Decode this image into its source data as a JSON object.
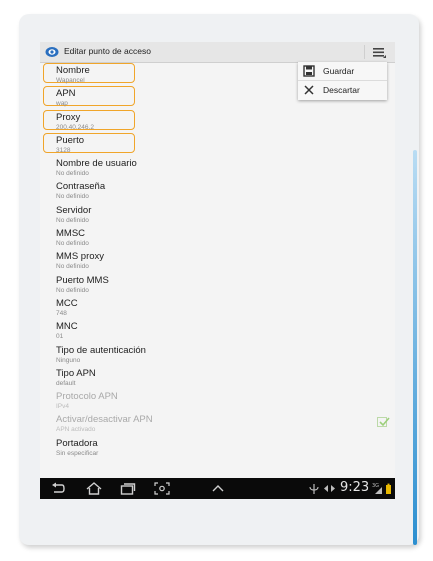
{
  "header": {
    "title": "Editar punto de acceso"
  },
  "overflow_menu": {
    "items": [
      {
        "label": "Guardar",
        "icon": "save-icon"
      },
      {
        "label": "Descartar",
        "icon": "close-icon"
      }
    ]
  },
  "settings": [
    {
      "label": "Nombre",
      "value": "Wapancel",
      "highlighted": true
    },
    {
      "label": "APN",
      "value": "wap",
      "highlighted": true
    },
    {
      "label": "Proxy",
      "value": "200.40.246.2",
      "highlighted": true
    },
    {
      "label": "Puerto",
      "value": "3128",
      "highlighted": true
    },
    {
      "label": "Nombre de usuario",
      "value": "No definido"
    },
    {
      "label": "Contraseña",
      "value": "No definido"
    },
    {
      "label": "Servidor",
      "value": "No definido"
    },
    {
      "label": "MMSC",
      "value": "No definido"
    },
    {
      "label": "MMS proxy",
      "value": "No definido"
    },
    {
      "label": "Puerto MMS",
      "value": "No definido"
    },
    {
      "label": "MCC",
      "value": "748"
    },
    {
      "label": "MNC",
      "value": "01"
    },
    {
      "label": "Tipo de autenticación",
      "value": "Ninguno"
    },
    {
      "label": "Tipo APN",
      "value": "default"
    },
    {
      "label": "Protocolo APN",
      "value": "IPv4",
      "disabled": true
    },
    {
      "label": "Activar/desactivar APN",
      "value": "APN activado",
      "disabled": true,
      "checkbox": true,
      "checked": true
    },
    {
      "label": "Portadora",
      "value": "Sin especificar"
    }
  ],
  "status_bar": {
    "time": "9:23"
  },
  "colors": {
    "highlight": "#f0a52a",
    "accent": "#2c8fd0",
    "navbar": "#0a0a0a"
  }
}
